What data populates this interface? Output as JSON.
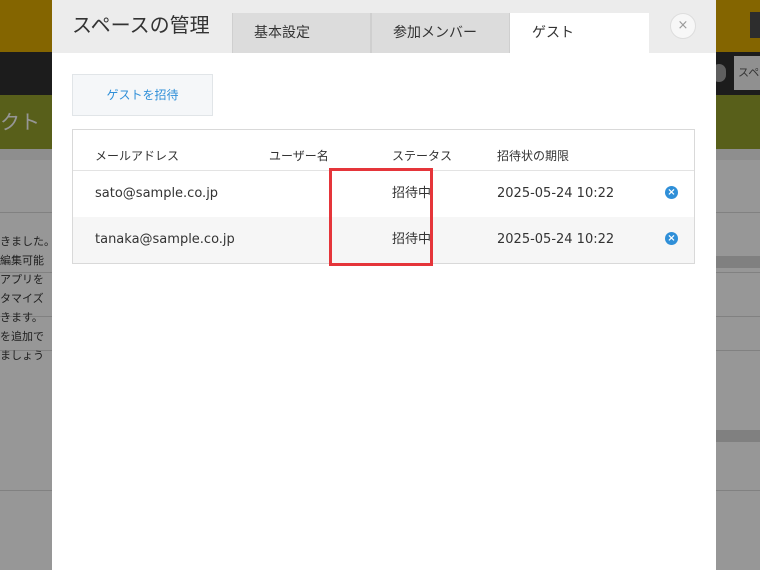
{
  "background": {
    "nav_button_label": "スペ",
    "title_text": "クト",
    "body_lines": [
      "きました。",
      "編集可能",
      "アプリを",
      "タマイズ",
      "きます。",
      "を追加で",
      "ましょう"
    ]
  },
  "modal": {
    "title": "スペースの管理",
    "tabs": [
      {
        "label": "基本設定",
        "active": false
      },
      {
        "label": "参加メンバー",
        "active": false
      },
      {
        "label": "ゲスト",
        "active": true
      }
    ],
    "close_label": "×",
    "invite_label": "ゲストを招待",
    "table": {
      "headers": [
        "メールアドレス",
        "ユーザー名",
        "ステータス",
        "招待状の期限"
      ],
      "rows": [
        {
          "email": "sato@sample.co.jp",
          "username": "",
          "status": "招待中",
          "expires": "2025-05-24 10:22"
        },
        {
          "email": "tanaka@sample.co.jp",
          "username": "",
          "status": "招待中",
          "expires": "2025-05-24 10:22"
        }
      ],
      "remove_icon": "×"
    }
  },
  "colors": {
    "header": "#d6a400",
    "title_bar": "#8e9a2b",
    "accent": "#2f8fd8",
    "highlight": "#e5353a"
  }
}
